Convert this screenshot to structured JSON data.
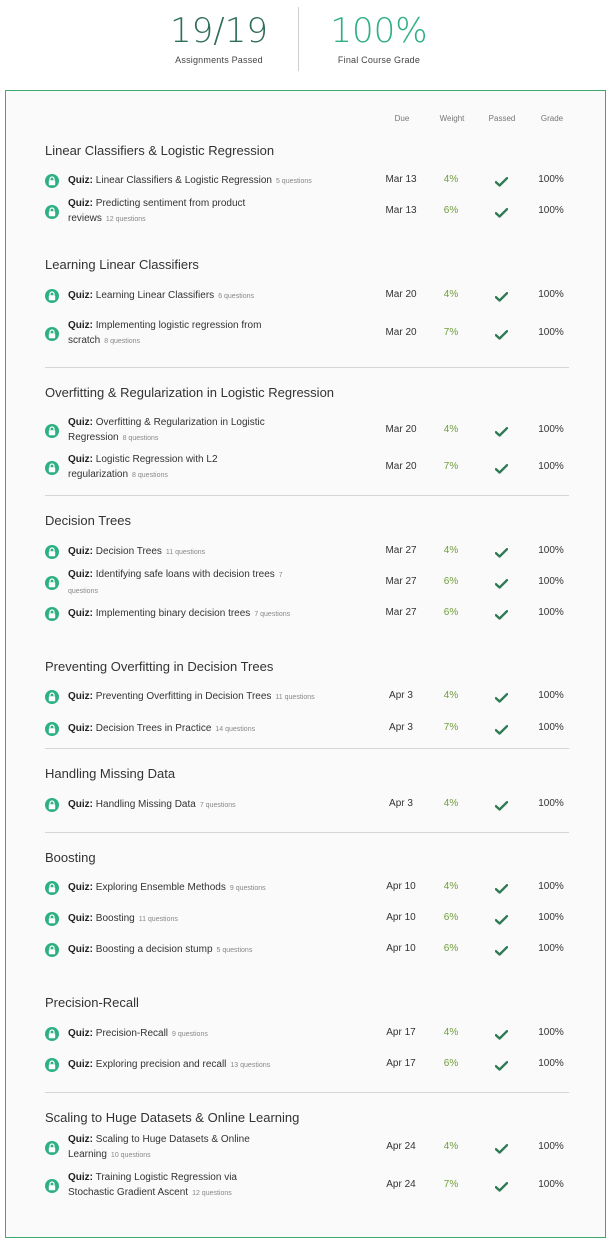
{
  "summary": {
    "assignments_value": "19/19",
    "assignments_label": "Assignments Passed",
    "grade_value": "100%",
    "grade_label": "Final Course Grade"
  },
  "columns": {
    "due": "Due",
    "weight": "Weight",
    "passed": "Passed",
    "grade": "Grade"
  },
  "colors": {
    "accent": "#2eb082",
    "dark_accent": "#2f6e5a",
    "weight": "#6f9e3b",
    "border": "#3fa86f"
  },
  "sections": [
    {
      "title": "Linear Classifiers & Logistic Regression",
      "items": [
        {
          "prefix": "Quiz:",
          "name": "Linear Classifiers & Logistic Regression",
          "questions": "5 questions",
          "due": "Mar 13",
          "weight": "4%",
          "grade": "100%"
        },
        {
          "prefix": "Quiz:",
          "name": "Predicting sentiment from product reviews",
          "questions": "12 questions",
          "due": "Mar 13",
          "weight": "6%",
          "grade": "100%"
        }
      ]
    },
    {
      "title": "Learning Linear Classifiers",
      "items": [
        {
          "prefix": "Quiz:",
          "name": "Learning Linear Classifiers",
          "questions": "6 questions",
          "due": "Mar 20",
          "weight": "4%",
          "grade": "100%"
        },
        {
          "prefix": "Quiz:",
          "name": "Implementing logistic regression from scratch",
          "questions": "8 questions",
          "due": "Mar 20",
          "weight": "7%",
          "grade": "100%"
        }
      ]
    },
    {
      "title": "Overfitting & Regularization in Logistic Regression",
      "items": [
        {
          "prefix": "Quiz:",
          "name": "Overfitting & Regularization in Logistic Regression",
          "questions": "8 questions",
          "due": "Mar 20",
          "weight": "4%",
          "grade": "100%"
        },
        {
          "prefix": "Quiz:",
          "name": "Logistic Regression with L2 regularization",
          "questions": "8 questions",
          "due": "Mar 20",
          "weight": "7%",
          "grade": "100%"
        }
      ]
    },
    {
      "title": "Decision Trees",
      "items": [
        {
          "prefix": "Quiz:",
          "name": "Decision Trees",
          "questions": "11 questions",
          "due": "Mar 27",
          "weight": "4%",
          "grade": "100%"
        },
        {
          "prefix": "Quiz:",
          "name": "Identifying safe loans with decision trees",
          "questions": "7 questions",
          "due": "Mar 27",
          "weight": "6%",
          "grade": "100%"
        },
        {
          "prefix": "Quiz:",
          "name": "Implementing binary decision trees",
          "questions": "7 questions",
          "due": "Mar 27",
          "weight": "6%",
          "grade": "100%"
        }
      ]
    },
    {
      "title": "Preventing Overfitting in Decision Trees",
      "items": [
        {
          "prefix": "Quiz:",
          "name": "Preventing Overfitting in Decision Trees",
          "questions": "11 questions",
          "due": "Apr 3",
          "weight": "4%",
          "grade": "100%"
        },
        {
          "prefix": "Quiz:",
          "name": "Decision Trees in Practice",
          "questions": "14 questions",
          "due": "Apr 3",
          "weight": "7%",
          "grade": "100%"
        }
      ]
    },
    {
      "title": "Handling Missing Data",
      "items": [
        {
          "prefix": "Quiz:",
          "name": "Handling Missing Data",
          "questions": "7 questions",
          "due": "Apr 3",
          "weight": "4%",
          "grade": "100%"
        }
      ]
    },
    {
      "title": "Boosting",
      "items": [
        {
          "prefix": "Quiz:",
          "name": "Exploring Ensemble Methods",
          "questions": "9 questions",
          "due": "Apr 10",
          "weight": "4%",
          "grade": "100%"
        },
        {
          "prefix": "Quiz:",
          "name": "Boosting",
          "questions": "11 questions",
          "due": "Apr 10",
          "weight": "6%",
          "grade": "100%"
        },
        {
          "prefix": "Quiz:",
          "name": "Boosting a decision stump",
          "questions": "5 questions",
          "due": "Apr 10",
          "weight": "6%",
          "grade": "100%"
        }
      ]
    },
    {
      "title": "Precision-Recall",
      "items": [
        {
          "prefix": "Quiz:",
          "name": "Precision-Recall",
          "questions": "9 questions",
          "due": "Apr 17",
          "weight": "4%",
          "grade": "100%"
        },
        {
          "prefix": "Quiz:",
          "name": "Exploring precision and recall",
          "questions": "13 questions",
          "due": "Apr 17",
          "weight": "6%",
          "grade": "100%"
        }
      ]
    },
    {
      "title": "Scaling to Huge Datasets & Online Learning",
      "items": [
        {
          "prefix": "Quiz:",
          "name": "Scaling to Huge Datasets & Online Learning",
          "questions": "10 questions",
          "due": "Apr 24",
          "weight": "4%",
          "grade": "100%"
        },
        {
          "prefix": "Quiz:",
          "name": "Training Logistic Regression via Stochastic Gradient Ascent",
          "questions": "12 questions",
          "due": "Apr 24",
          "weight": "7%",
          "grade": "100%"
        }
      ]
    }
  ]
}
